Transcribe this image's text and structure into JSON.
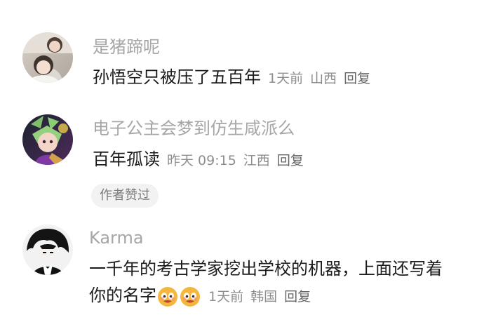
{
  "comments": [
    {
      "username": "是猪蹄呢",
      "content": "孙悟空只被压了五百年",
      "time": "1天前",
      "location": "山西",
      "reply_label": "回复"
    },
    {
      "username": "电子公主会梦到仿生咸派么",
      "content": "百年孤读",
      "time": "昨天 09:15",
      "location": "江西",
      "reply_label": "回复",
      "badge": "作者赞过"
    },
    {
      "username": "Karma",
      "content": "一千年的考古学家挖出学校的机器，上面还写着你的名字",
      "time": "1天前",
      "location": "韩国",
      "reply_label": "回复",
      "emojis": [
        "smiling-face-emoji",
        "smiling-face-emoji"
      ]
    }
  ],
  "colors": {
    "username": "#a6a6a6",
    "content": "#1b1b1b",
    "meta": "#8e8e8e",
    "badge_bg": "#f2f2f2"
  }
}
